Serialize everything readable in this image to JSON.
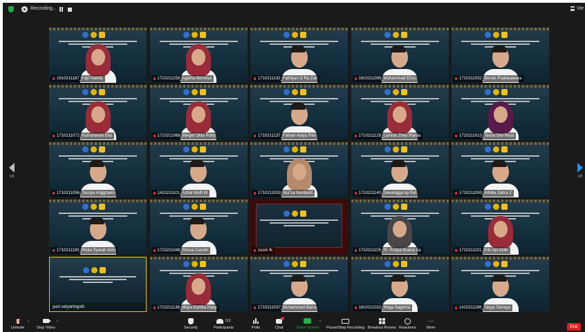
{
  "topbar": {
    "recording_label": "Recording...",
    "view_label": "Vie"
  },
  "nav": {
    "left_page": "1/5",
    "right_page": "1/5"
  },
  "tiles": [
    {
      "name": "1610211187_Fajri Hanifa",
      "person": "hijab"
    },
    {
      "name": "1710211159_Agatha Bennisa",
      "person": "hijab"
    },
    {
      "name": "1710211132_Fathiyan D Ra Zafi",
      "person": "man"
    },
    {
      "name": "1610211095_Muhammad Enzo",
      "person": "man"
    },
    {
      "name": "1710211032_Bernie Prakasawara",
      "person": "man"
    },
    {
      "name": "1710211072_Kumarawati Eka",
      "person": "hijab"
    },
    {
      "name": "1710211068_Berget Okta Putry",
      "person": "hijab"
    },
    {
      "name": "1710211137_Fathan Aulya Fikri",
      "person": "man"
    },
    {
      "name": "1710211129_Lamida Zhea Ramla",
      "person": "hijab"
    },
    {
      "name": "1710211013_Tarisa Dwi Rival",
      "person": "hijab-dark"
    },
    {
      "name": "1710211056_Tasnya Anggraeni",
      "person": "woman"
    },
    {
      "name": "1410211101_Azhal Mufti W",
      "person": "man"
    },
    {
      "name": "1710211033_Nur'sa Nurdianti",
      "person": "hijab-beige"
    },
    {
      "name": "1710211140_Dewangga Aji Raf",
      "person": "man"
    },
    {
      "name": "1710211093_Athiba Zahra Z",
      "person": "woman"
    },
    {
      "name": "1710211100_Ristia Syarah Anin",
      "person": "woman"
    },
    {
      "name": "1710211048_Rossa Carolin",
      "person": "woman"
    },
    {
      "name": "zoom fk",
      "person": "none"
    },
    {
      "name": "1710211105_Rr. Puspa Buana Sa",
      "person": "hijab-gray"
    },
    {
      "name": "1710211101_Erik Aju Azile",
      "person": "hijab"
    },
    {
      "name": "yuni setyaningsih",
      "person": "none"
    },
    {
      "name": "1710211136_Maya Kartika Hasy",
      "person": "hijab"
    },
    {
      "name": "1710211037_Muhammad Barra",
      "person": "man"
    },
    {
      "name": "1610211010_Noga Sagema",
      "person": "man"
    },
    {
      "name": "1410211198_Tasya Tamaya",
      "person": "woman"
    }
  ],
  "toolbar": {
    "unmute": "Unmute",
    "stop_video": "Stop Video",
    "security": "Security",
    "participants": "Participants",
    "participants_count": "113",
    "polls": "Polls",
    "chat": "Chat",
    "share_screen": "Share Screen",
    "record": "Pause/Stop Recording",
    "breakout": "Breakout Rooms",
    "reactions": "Reactions",
    "more": "More",
    "end": "End"
  },
  "colors": {
    "share": "#1fb24a",
    "end": "#e02020",
    "highlight": "#e6d000"
  }
}
